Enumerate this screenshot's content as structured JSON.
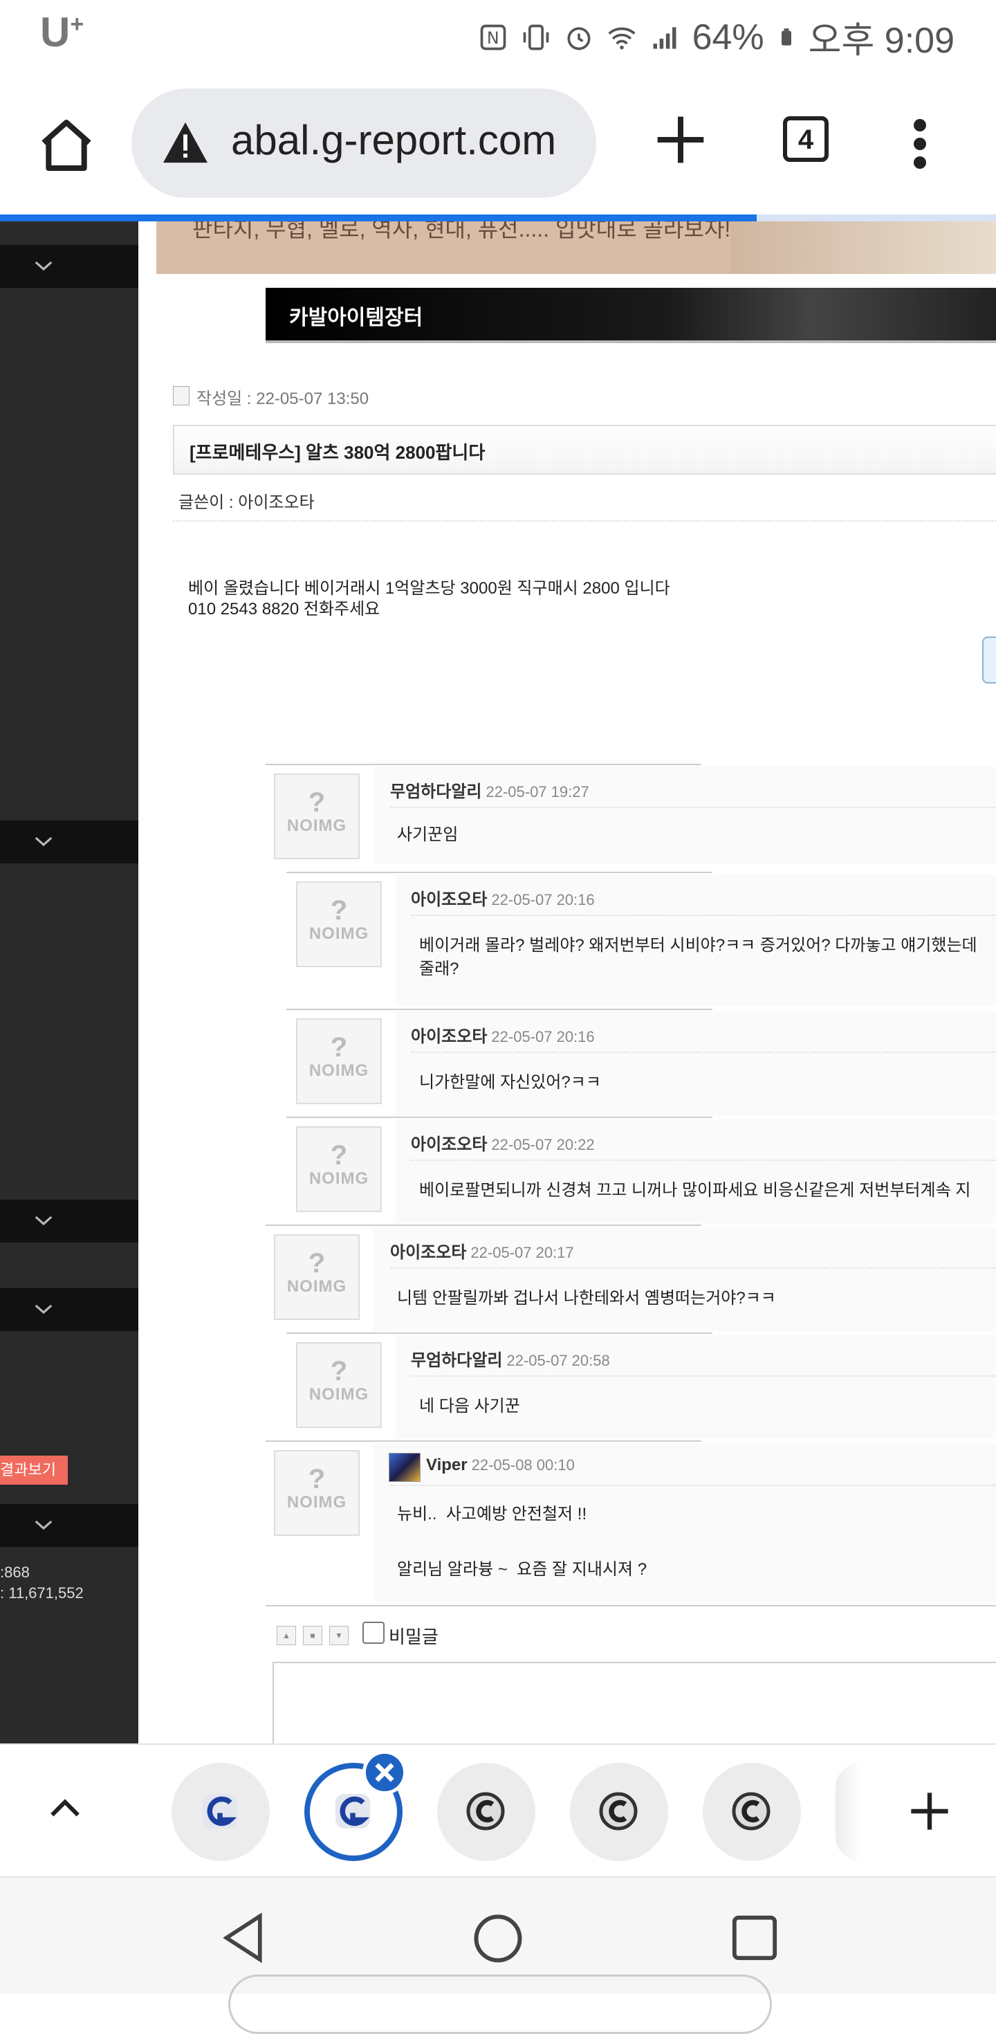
{
  "status": {
    "carrier": "U",
    "carrier_sup": "+",
    "battery": "64%",
    "time": "오후 9:09"
  },
  "browser": {
    "url": "abal.g-report.com",
    "tab_count": "4",
    "load_progress": 0.76
  },
  "sidebar": {
    "badge": "결과보기",
    "stats": [
      ":868",
      ": 11,671,552"
    ]
  },
  "banner": {
    "text": "판타지, 무협, 멜로, 역사, 현대, 퓨전..... 입맛대로 골라보자!"
  },
  "post": {
    "section_title": "카발아이템장터",
    "date_label": "작성일 : 22-05-07 13:50",
    "title": "[프로메테우스] 알츠 380억 2800팝니다",
    "author_label": "글쓴이 : 아이조오타",
    "body_line1": "베이 올렸습니다 베이거래시 1억알츠당 3000원 직구매시 2800 입니다",
    "body_line2": "010 2543 8820 전화주세요"
  },
  "comments": [
    {
      "name": "무엄하다알리",
      "date": "22-05-07 19:27",
      "text": "사기꾼임"
    },
    {
      "name": "아이조오타",
      "date": "22-05-07 20:16",
      "text": "베이거래 몰라? 벌레야? 왜저번부터 시비야?ㅋㅋ 증거있어? 다까놓고 얘기했는데",
      "text2": "줄래?"
    },
    {
      "name": "아이조오타",
      "date": "22-05-07 20:16",
      "text": "니가한말에 자신있어?ㅋㅋ"
    },
    {
      "name": "아이조오타",
      "date": "22-05-07 20:22",
      "text": "베이로팔면되니까 신경쳐 끄고 니꺼나 많이파세요 비응신같은게 저번부터계속 지"
    },
    {
      "name": "아이조오타",
      "date": "22-05-07 20:17",
      "text": "니템 안팔릴까봐 겁나서 나한테와서 옘병떠는거야?ㅋㅋ"
    },
    {
      "name": "무엄하다알리",
      "date": "22-05-07 20:58",
      "text": "네 다음 사기꾼"
    },
    {
      "name": "Viper",
      "date": "22-05-08 00:10",
      "text": "뉴비..  사고예방 안전철저 !!",
      "text2": "알리님 알라븅 ~  요즘 잘 지내시져 ?"
    }
  ],
  "avatar": {
    "q": "?",
    "label": "NOIMG"
  },
  "editor": {
    "secret_label": "비밀글",
    "buttons": [
      "▲",
      "■",
      "▼"
    ]
  },
  "colors": {
    "accent": "#1e63c4",
    "progress": "#1a73e8",
    "badge": "#f06a5d",
    "sidebar": "#2a2a2a"
  }
}
